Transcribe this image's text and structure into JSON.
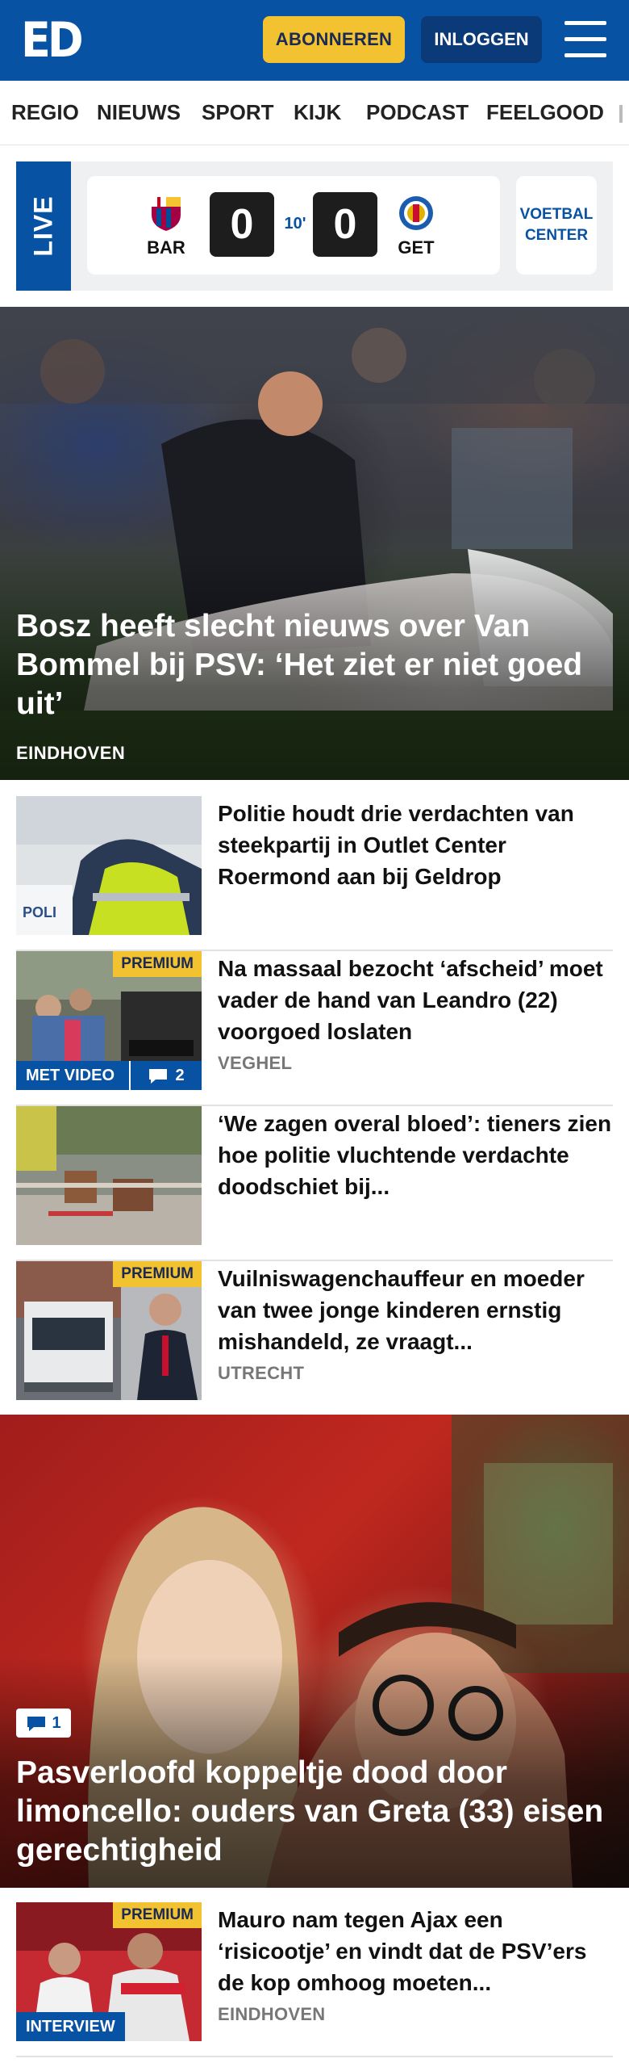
{
  "header": {
    "logo": "ED",
    "subscribe_label": "ABONNEREN",
    "login_label": "INLOGGEN",
    "menu_icon": "hamburger-menu-icon",
    "brand_color": "#0752a3",
    "accent_color": "#f2c230"
  },
  "nav": {
    "items": [
      "REGIO",
      "NIEUWS",
      "SPORT",
      "KIJK",
      "PODCAST",
      "FEELGOOD"
    ]
  },
  "live": {
    "label": "LIVE",
    "home_team": "BAR",
    "home_score": "0",
    "minute": "10'",
    "away_score": "0",
    "away_team": "GET",
    "center_label": "VOETBAL CENTER"
  },
  "hero": {
    "title": "Bosz heeft slecht nieuws over Van Bommel bij PSV: ‘Het ziet er niet goed uit’",
    "location": "EINDHOVEN"
  },
  "articles": [
    {
      "title": "Politie houdt drie verdachten van steekpartij in Outlet Center Roermond aan bij Geldrop",
      "location": ""
    },
    {
      "title": "Na massaal bezocht ‘afscheid’ moet vader de hand van Leandro (22) voorgoed loslaten",
      "location": "VEGHEL",
      "premium": "PREMIUM",
      "video_label": "MET VIDEO",
      "comments": "2"
    },
    {
      "title": "‘We zagen overal bloed’: tieners zien hoe politie vluchtende verdachte doodschiet bij...",
      "location": ""
    },
    {
      "title": "Vuilniswagenchauffeur en moeder van twee jonge kinderen ernstig mishandeld, ze vraagt...",
      "location": "UTRECHT",
      "premium": "PREMIUM"
    }
  ],
  "feature": {
    "comments": "1",
    "title": "Pasverloofd koppeltje dood door limoncello: ouders van Greta (33) eisen gerechtigheid"
  },
  "article_last": {
    "title": "Mauro nam tegen Ajax een ‘risicootje’ en vindt dat de PSV’ers de kop omhoog moeten...",
    "location": "EINDHOVEN",
    "premium": "PREMIUM",
    "tag": "INTERVIEW"
  }
}
